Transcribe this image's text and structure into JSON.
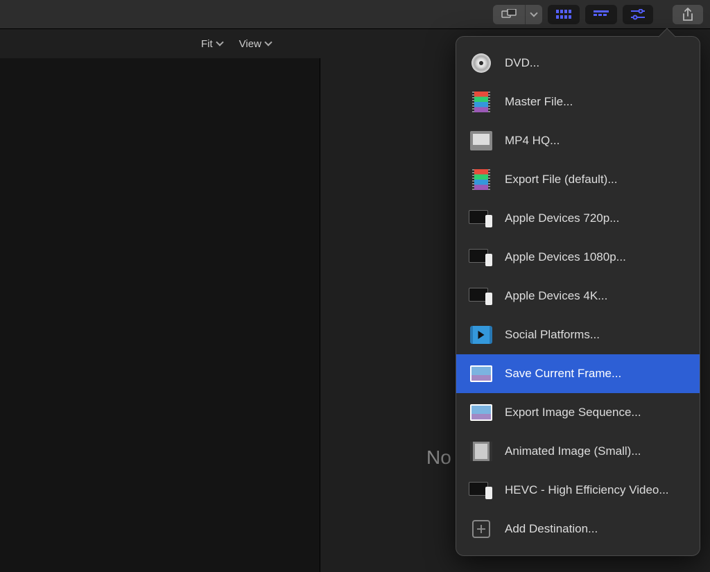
{
  "secondary_bar": {
    "fit_label": "Fit",
    "view_label": "View"
  },
  "viewer": {
    "partial_text": "No"
  },
  "share_menu": {
    "items": [
      {
        "label": "DVD...",
        "icon": "dvd",
        "highlighted": false
      },
      {
        "label": "Master File...",
        "icon": "filmstrip",
        "highlighted": false
      },
      {
        "label": "MP4 HQ...",
        "icon": "mp4",
        "highlighted": false
      },
      {
        "label": "Export File (default)...",
        "icon": "filmstrip",
        "highlighted": false
      },
      {
        "label": "Apple Devices 720p...",
        "icon": "devices",
        "highlighted": false
      },
      {
        "label": "Apple Devices 1080p...",
        "icon": "devices",
        "highlighted": false
      },
      {
        "label": "Apple Devices 4K...",
        "icon": "devices",
        "highlighted": false
      },
      {
        "label": "Social Platforms...",
        "icon": "social",
        "highlighted": false
      },
      {
        "label": "Save Current Frame...",
        "icon": "frame",
        "highlighted": true
      },
      {
        "label": "Export Image Sequence...",
        "icon": "frame",
        "highlighted": false
      },
      {
        "label": "Animated Image (Small)...",
        "icon": "animated",
        "highlighted": false
      },
      {
        "label": "HEVC - High Efficiency Video...",
        "icon": "devices",
        "highlighted": false
      },
      {
        "label": "Add Destination...",
        "icon": "plus",
        "highlighted": false
      }
    ]
  }
}
